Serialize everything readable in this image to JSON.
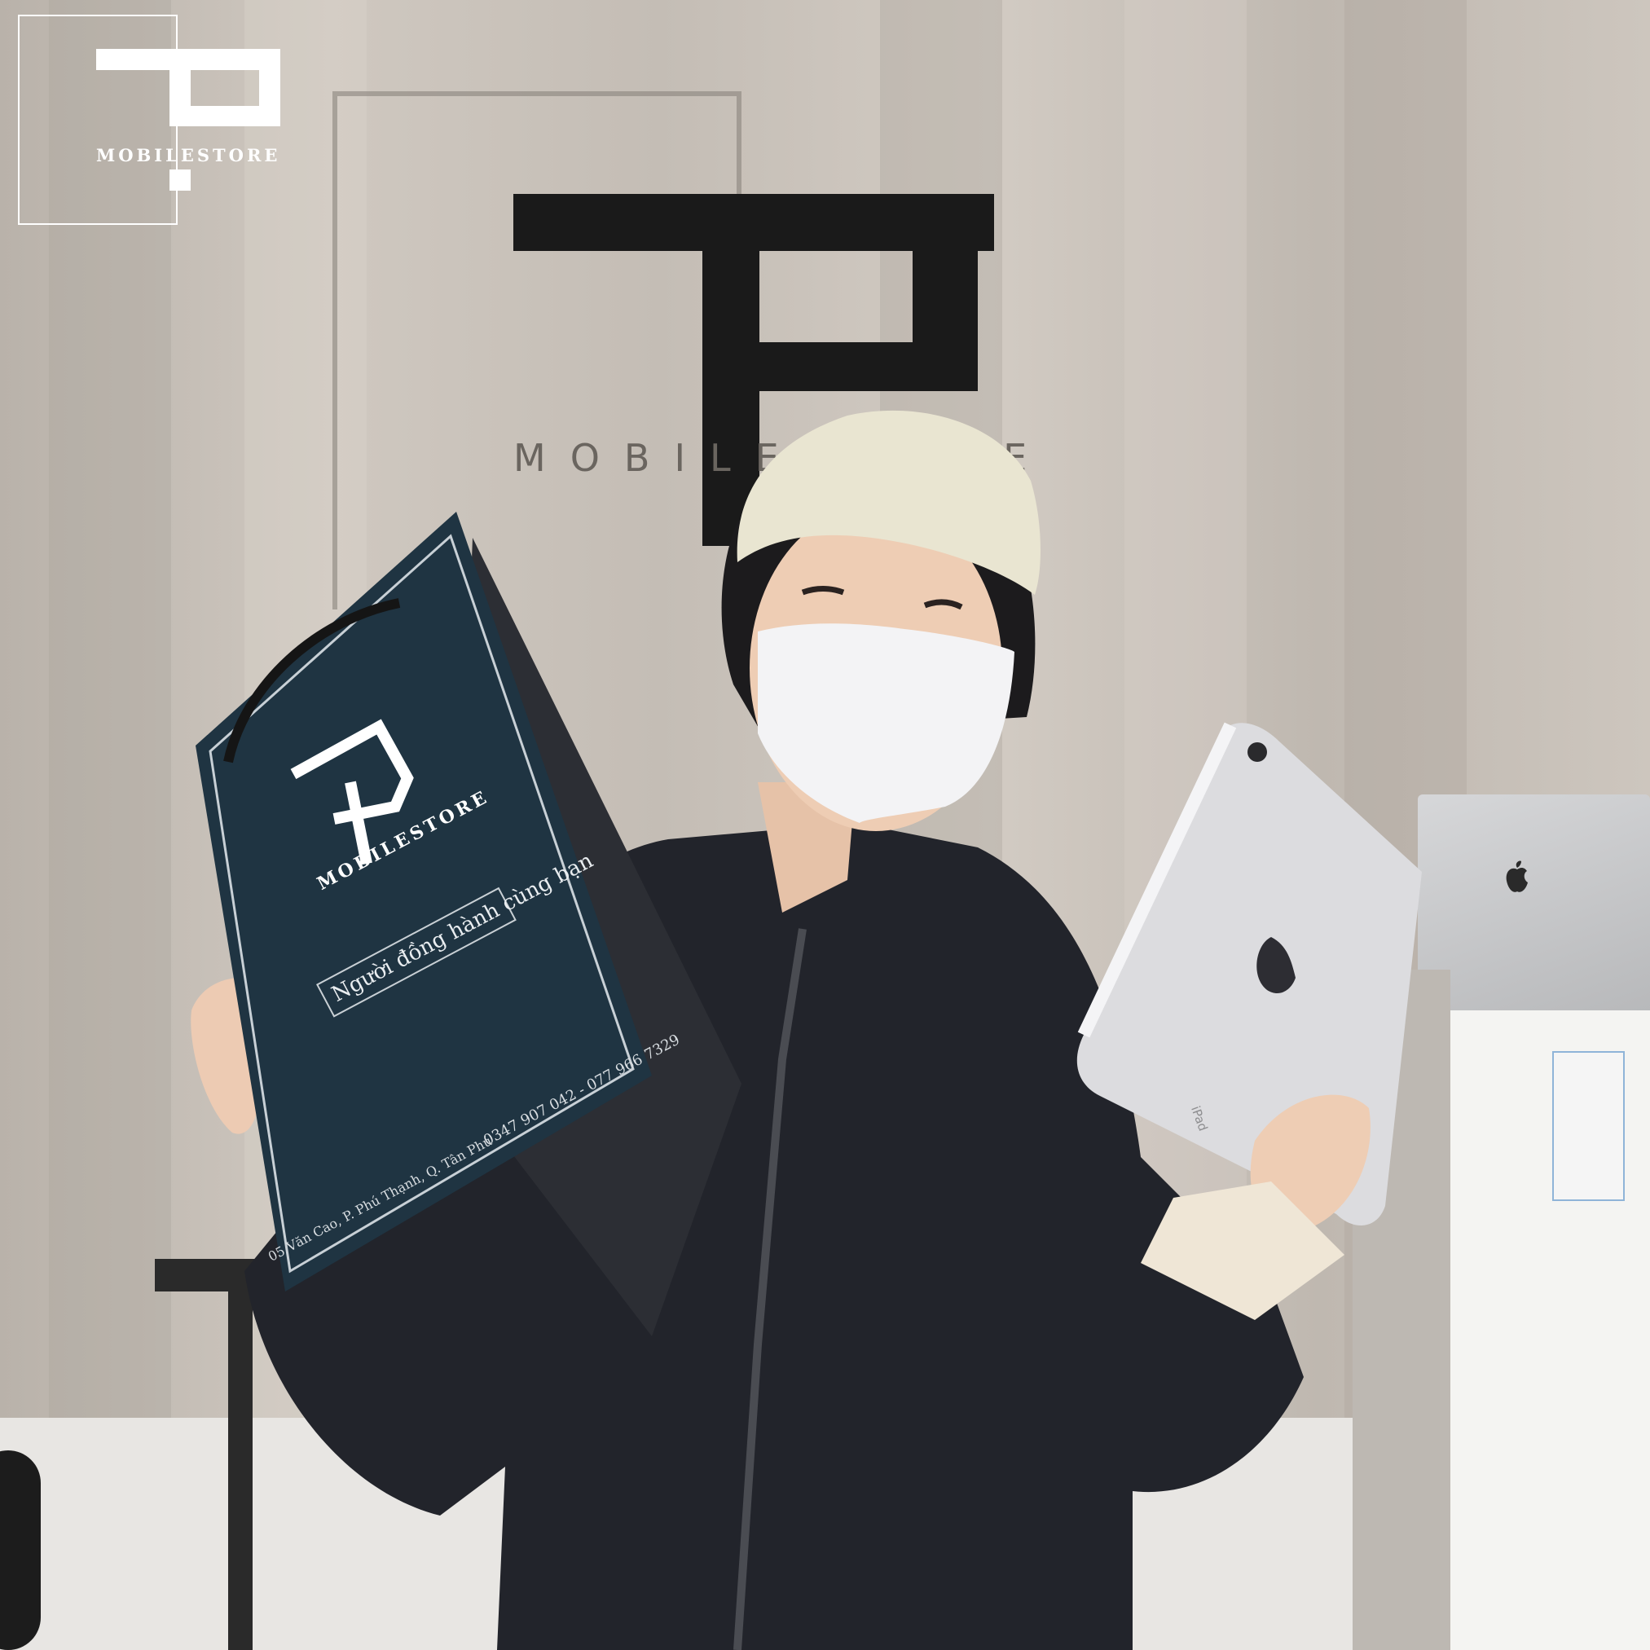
{
  "watermark": {
    "brand_text": "MOBILESTORE"
  },
  "wall_sign": {
    "text": "MOBILESTORE"
  },
  "bag": {
    "brand_text": "MOBILESTORE",
    "slogan": "Người đồng hành cùng bạn",
    "phones": "0347 907 042 - 077 966 7329",
    "address": "05 Văn Cao, P. Phú Thạnh, Q. Tân Phú"
  },
  "ipad": {
    "label": "iPad"
  },
  "colors": {
    "wall": "#c9c2ba",
    "bag": "#1f3442",
    "jacket": "#22242b",
    "cap": "#e8e4cf",
    "mask": "#f2f2f4",
    "ipad": "#dcdcdf"
  }
}
